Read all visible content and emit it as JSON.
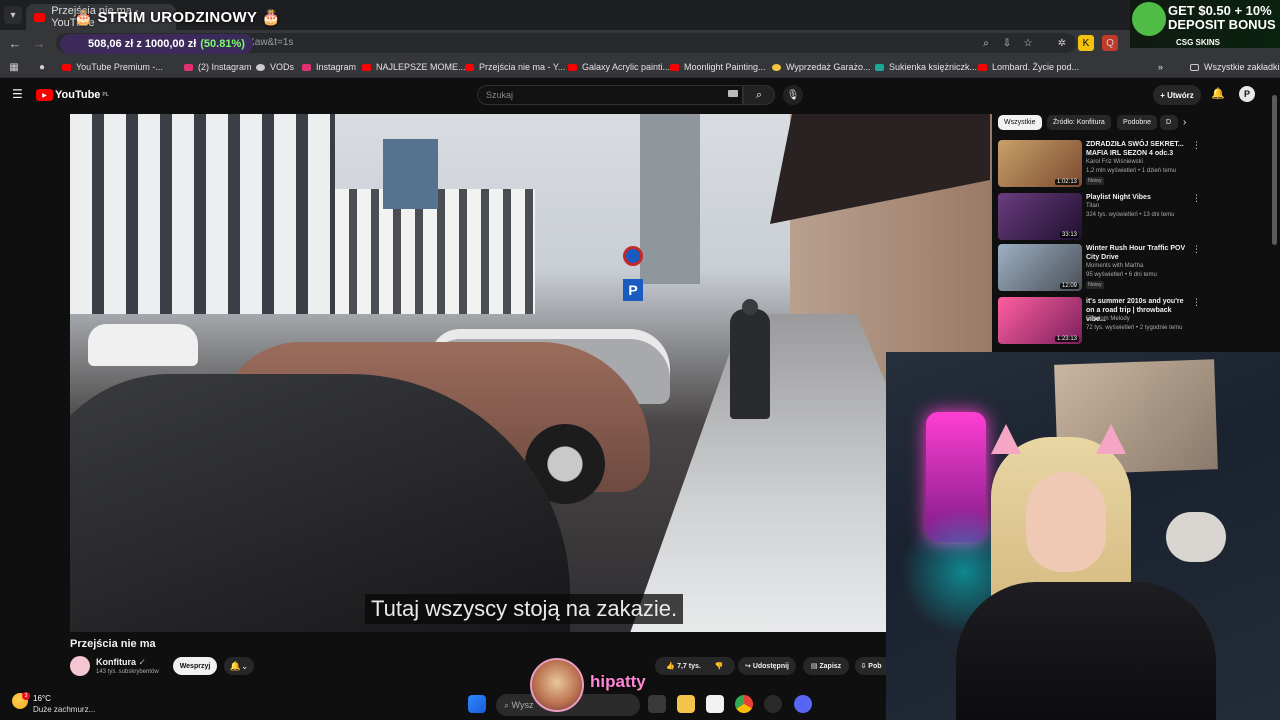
{
  "browser": {
    "tab_title": "Przejścia nie ma - YouTube",
    "url": "...g=rvRcnY9Kaw&t=1s",
    "bookmarks": [
      {
        "label": "YouTube Premium -...",
        "color": "#ff0000"
      },
      {
        "label": "(2) Instagram",
        "color": "#e1306c"
      },
      {
        "label": "VODs",
        "color": "#cccccc"
      },
      {
        "label": "Instagram",
        "color": "#e1306c"
      },
      {
        "label": "NAJLEPSZE MOME...",
        "color": "#ff0000"
      },
      {
        "label": "Przejścia nie ma - Y...",
        "color": "#ff0000"
      },
      {
        "label": "Galaxy Acrylic painti...",
        "color": "#ff0000"
      },
      {
        "label": "Moonlight Painting...",
        "color": "#ff0000"
      },
      {
        "label": "Wyprzedaż Garażo...",
        "color": "#f5c542"
      },
      {
        "label": "Sukienka księżniczk...",
        "color": "#18a999"
      },
      {
        "label": "Lombard. Życie pod...",
        "color": "#ff0000"
      }
    ],
    "all_bookmarks": "Wszystkie zakładki"
  },
  "overlay": {
    "stream_title": "STRIM URODZINOWY",
    "donation_current": "508,06 zł",
    "donation_sep": "z",
    "donation_goal": "1000,00 zł",
    "donation_pct": "(50.81%)",
    "streamer_name": "hipatty"
  },
  "ad": {
    "line1": "GET $0.50 + 10%",
    "line2": "DEPOSIT BONUS",
    "brand": "CSG SKINS"
  },
  "youtube": {
    "logo": "YouTube",
    "region": "PL",
    "search_placeholder": "Szukaj",
    "create_label": "Utwórz",
    "avatar_letter": "P"
  },
  "video": {
    "subtitle": "Tutaj wszyscy stoją na zakazie.",
    "title": "Przejścia nie ma",
    "channel": "Konfitura",
    "subscribers": "143 tys. subskrybentów",
    "support_label": "Wesprzyj",
    "likes": "7,7 tys.",
    "share_label": "Udostępnij",
    "save_label": "Zapisz",
    "more_label": "Pob"
  },
  "sidebar": {
    "chips": [
      "Wszystkie",
      "Źródło: Konfitura",
      "Podobne",
      "D"
    ],
    "recommendations": [
      {
        "title": "ZDRADZIŁA SWÓJ SEKRET... MAFIA IRL SEZON 4 odc.3",
        "channel": "Karol Friz Wiśniewski",
        "meta": "1,2 mln wyświetleń • 1 dzień temu",
        "badge": "Nowy",
        "duration": "1:02:13",
        "color1": "#c9a06a",
        "color2": "#7a4b2f"
      },
      {
        "title": "Playlist Night Vibes",
        "channel": "Titan",
        "meta": "324 tys. wyświetleń • 13 dni temu",
        "badge": "",
        "duration": "33:13",
        "color1": "#6b3d7e",
        "color2": "#201030"
      },
      {
        "title": "Winter Rush Hour Traffic POV City Drive",
        "channel": "Moments with Martha",
        "meta": "95 wyświetleń • 6 dni temu",
        "badge": "Nowy",
        "duration": "12:09",
        "color1": "#9db0c4",
        "color2": "#4a4f57"
      },
      {
        "title": "it's summer 2010s and you're on a road trip | throwback vibe...",
        "channel": "Random Melody",
        "meta": "72 tys. wyświetleń • 2 tygodnie temu",
        "badge": "",
        "duration": "1:23:13",
        "color1": "#ff5fa0",
        "color2": "#7a1f5c"
      }
    ]
  },
  "taskbar": {
    "weather_temp": "16°C",
    "weather_desc": "Duże zachmurz...",
    "weather_badge": "3",
    "search_placeholder": "Wysz"
  }
}
